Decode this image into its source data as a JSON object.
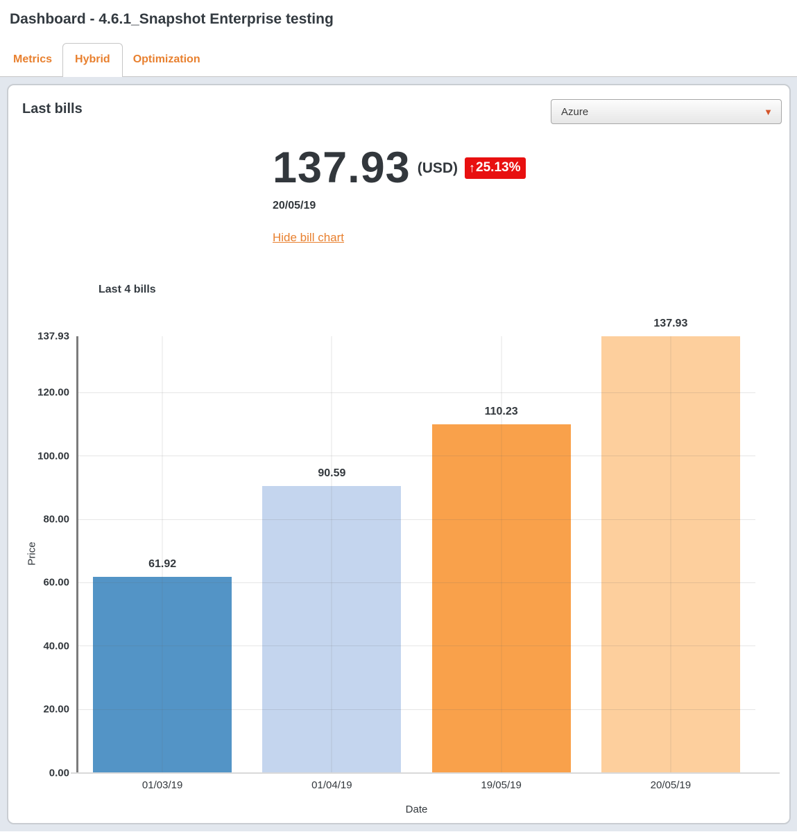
{
  "page": {
    "title": "Dashboard - 4.6.1_Snapshot Enterprise testing"
  },
  "tabs": [
    {
      "label": "Metrics",
      "active": false
    },
    {
      "label": "Hybrid",
      "active": true
    },
    {
      "label": "Optimization",
      "active": false
    }
  ],
  "panel": {
    "title": "Last bills",
    "provider_dropdown": {
      "value": "Azure",
      "caret_icon": "caret-down",
      "caret_glyph": "▼"
    },
    "summary": {
      "amount": "137.93",
      "currency": "(USD)",
      "change_badge": {
        "direction": "up",
        "arrow_glyph": "↑",
        "text": "25.13%",
        "color": "#e81010"
      },
      "date": "20/05/19",
      "toggle_link": "Hide bill chart"
    }
  },
  "chart_data": {
    "type": "bar",
    "title": "Last 4 bills",
    "categories": [
      "01/03/19",
      "01/04/19",
      "19/05/19",
      "20/05/19"
    ],
    "values": [
      61.92,
      90.59,
      110.23,
      137.93
    ],
    "value_labels": [
      "61.92",
      "90.59",
      "110.23",
      "137.93"
    ],
    "bar_colors": [
      "#5394c6",
      "#c4d5ee",
      "#f9a14b",
      "#fdcf9d"
    ],
    "xlabel": "Date",
    "ylabel": "Price",
    "ylim": [
      0,
      137.93
    ],
    "yticks": [
      0,
      20,
      40,
      60,
      80,
      100,
      120,
      137.93
    ],
    "ytick_labels": [
      "0.00",
      "20.00",
      "40.00",
      "60.00",
      "80.00",
      "100.00",
      "120.00",
      "137.93"
    ],
    "grid": true,
    "legend": false
  },
  "colors": {
    "accent_orange": "#e8802f",
    "badge_red": "#e81010",
    "heading_text": "#333a40",
    "section_background": "#e2e7ee",
    "panel_border": "#c9cdd2",
    "axis_line": "#7c7c7c"
  }
}
